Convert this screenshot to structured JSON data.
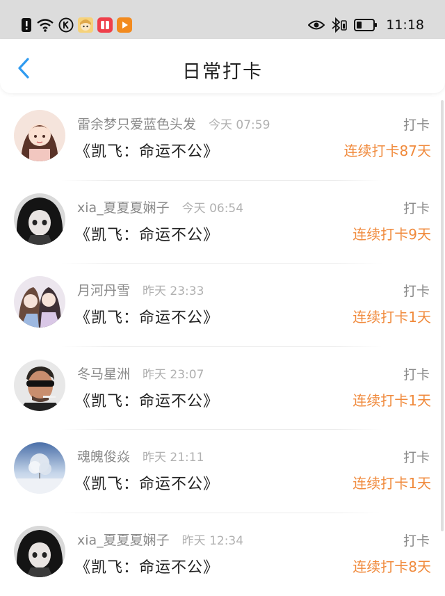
{
  "status_bar": {
    "time": "11:18",
    "left_icons": [
      "alert-icon",
      "wifi-icon",
      "k-badge-icon",
      "app-avatar-icon",
      "red-book-icon",
      "video-play-icon"
    ],
    "right_icons": [
      "eye-icon",
      "bluetooth-icon",
      "battery-icon"
    ]
  },
  "header": {
    "title": "日常打卡"
  },
  "list": {
    "items": [
      {
        "name": "雷余梦只爱蓝色头发",
        "time": "今天 07:59",
        "book": "《凯飞：命运不公》",
        "action": "打卡",
        "streak": "连续打卡87天"
      },
      {
        "name": "xia_夏夏夏娴子",
        "time": "今天 06:54",
        "book": "《凯飞：命运不公》",
        "action": "打卡",
        "streak": "连续打卡9天"
      },
      {
        "name": "月河丹雪",
        "time": "昨天 23:33",
        "book": "《凯飞：命运不公》",
        "action": "打卡",
        "streak": "连续打卡1天"
      },
      {
        "name": "冬马星洲",
        "time": "昨天 23:07",
        "book": "《凯飞：命运不公》",
        "action": "打卡",
        "streak": "连续打卡1天"
      },
      {
        "name": "魂魄俊焱",
        "time": "昨天 21:11",
        "book": "《凯飞：命运不公》",
        "action": "打卡",
        "streak": "连续打卡1天"
      },
      {
        "name": "xia_夏夏夏娴子",
        "time": "昨天 12:34",
        "book": "《凯飞：命运不公》",
        "action": "打卡",
        "streak": "连续打卡8天"
      }
    ]
  },
  "colors": {
    "accent": "#f08a3c",
    "back": "#2f9bf0",
    "status_bg": "#dcdcdc"
  }
}
